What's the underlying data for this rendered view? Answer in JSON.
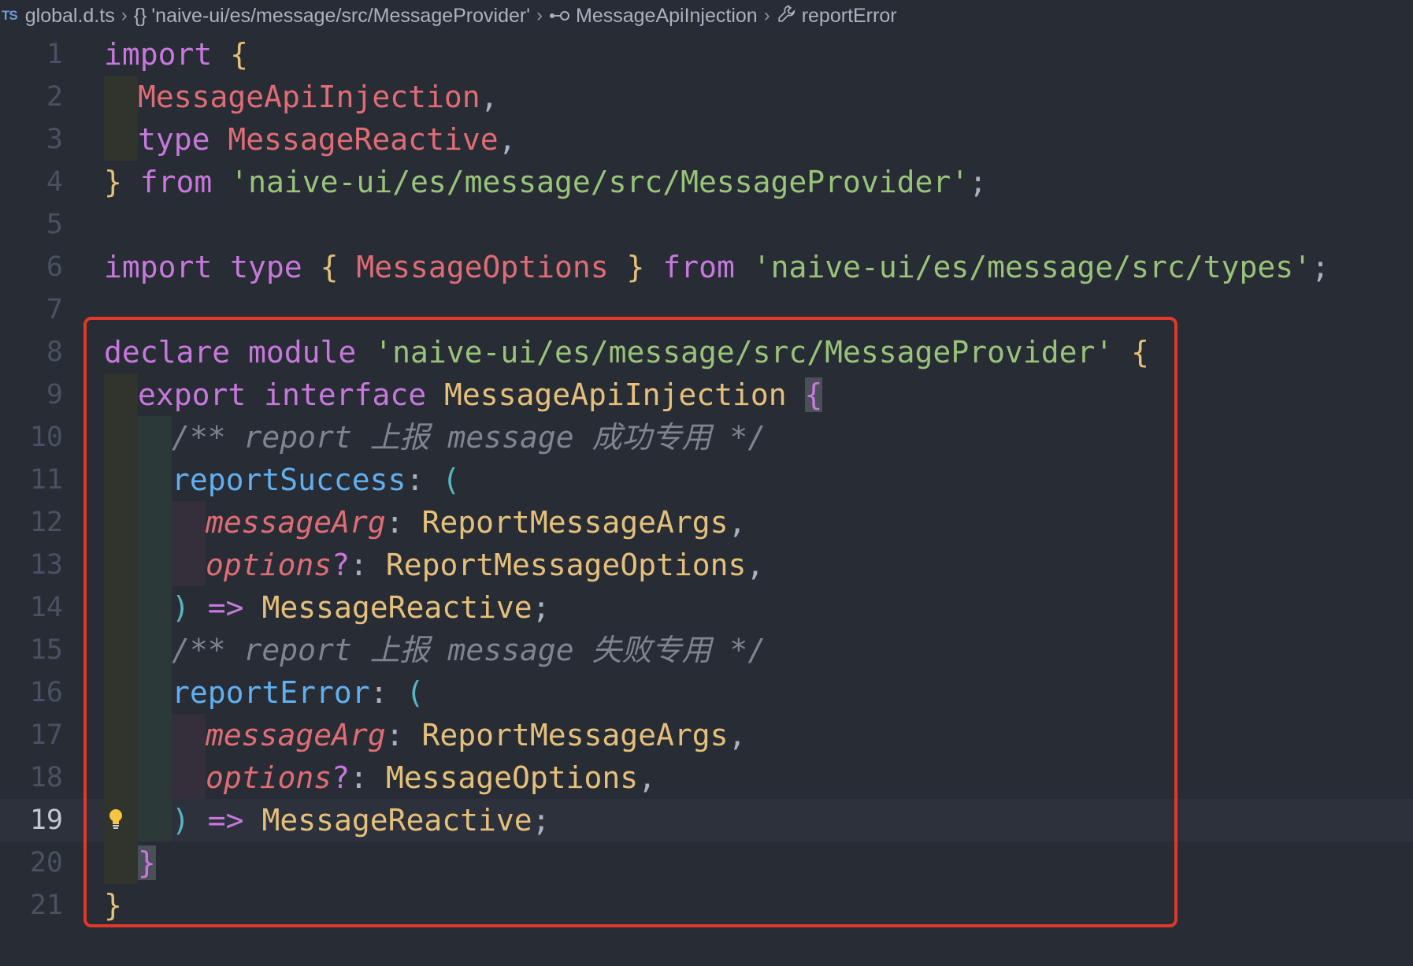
{
  "breadcrumb": {
    "lang_badge": "TS",
    "file": "global.d.ts",
    "module_icon": "{}",
    "module": "'naive-ui/es/message/src/MessageProvider'",
    "interface": "MessageApiInjection",
    "member": "reportError"
  },
  "current_line": 19,
  "lines": [
    {
      "n": "1",
      "tokens": [
        [
          "import",
          "kw"
        ],
        [
          " ",
          ""
        ],
        [
          "{",
          "br1"
        ]
      ]
    },
    {
      "n": "2",
      "tokens": [
        [
          "MessageApiInjection",
          "var"
        ],
        [
          ",",
          ""
        ]
      ]
    },
    {
      "n": "3",
      "tokens": [
        [
          "type",
          "kw"
        ],
        [
          " ",
          ""
        ],
        [
          "MessageReactive",
          "var"
        ],
        [
          ",",
          ""
        ]
      ]
    },
    {
      "n": "4",
      "tokens": [
        [
          "}",
          "br1"
        ],
        [
          " ",
          ""
        ],
        [
          "from",
          "kw"
        ],
        [
          " ",
          ""
        ],
        [
          "'naive-ui/es/message/src/MessageProvider'",
          "str"
        ],
        [
          ";",
          ""
        ]
      ]
    },
    {
      "n": "5",
      "tokens": []
    },
    {
      "n": "6",
      "tokens": [
        [
          "import",
          "kw"
        ],
        [
          " ",
          ""
        ],
        [
          "type",
          "kw"
        ],
        [
          " ",
          ""
        ],
        [
          "{",
          "br1"
        ],
        [
          " ",
          ""
        ],
        [
          "MessageOptions",
          "var"
        ],
        [
          " ",
          ""
        ],
        [
          "}",
          "br1"
        ],
        [
          " ",
          ""
        ],
        [
          "from",
          "kw"
        ],
        [
          " ",
          ""
        ],
        [
          "'naive-ui/es/message/src/types'",
          "str"
        ],
        [
          ";",
          ""
        ]
      ]
    },
    {
      "n": "7",
      "tokens": []
    },
    {
      "n": "8",
      "tokens": [
        [
          "declare",
          "kw"
        ],
        [
          " ",
          ""
        ],
        [
          "module",
          "kw"
        ],
        [
          " ",
          ""
        ],
        [
          "'naive-ui/es/message/src/MessageProvider'",
          "str"
        ],
        [
          " ",
          ""
        ],
        [
          "{",
          "br1"
        ]
      ]
    },
    {
      "n": "9",
      "tokens": [
        [
          "export",
          "kw"
        ],
        [
          " ",
          ""
        ],
        [
          "interface",
          "kw"
        ],
        [
          " ",
          ""
        ],
        [
          "MessageApiInjection",
          "ty"
        ],
        [
          " ",
          ""
        ],
        [
          "{",
          "br2 hl"
        ]
      ]
    },
    {
      "n": "10",
      "tokens": [
        [
          "/** report 上报 message 成功专用 */",
          "cm"
        ]
      ]
    },
    {
      "n": "11",
      "tokens": [
        [
          "reportSuccess",
          "prop"
        ],
        [
          ": ",
          ""
        ],
        [
          "(",
          "br3"
        ]
      ]
    },
    {
      "n": "12",
      "tokens": [
        [
          "messageArg",
          "par"
        ],
        [
          ": ",
          ""
        ],
        [
          "ReportMessageArgs",
          "ty"
        ],
        [
          ",",
          ""
        ]
      ]
    },
    {
      "n": "13",
      "tokens": [
        [
          "options",
          "par"
        ],
        [
          "?",
          "kw"
        ],
        [
          ": ",
          ""
        ],
        [
          "ReportMessageOptions",
          "ty"
        ],
        [
          ",",
          ""
        ]
      ]
    },
    {
      "n": "14",
      "tokens": [
        [
          ")",
          "br3"
        ],
        [
          " ",
          ""
        ],
        [
          "=>",
          "kw"
        ],
        [
          " ",
          ""
        ],
        [
          "MessageReactive",
          "ty"
        ],
        [
          ";",
          ""
        ]
      ]
    },
    {
      "n": "15",
      "tokens": [
        [
          "/** report 上报 message 失败专用 */",
          "cm"
        ]
      ]
    },
    {
      "n": "16",
      "tokens": [
        [
          "reportError",
          "prop"
        ],
        [
          ": ",
          ""
        ],
        [
          "(",
          "br3"
        ]
      ]
    },
    {
      "n": "17",
      "tokens": [
        [
          "messageArg",
          "par"
        ],
        [
          ": ",
          ""
        ],
        [
          "ReportMessageArgs",
          "ty"
        ],
        [
          ",",
          ""
        ]
      ]
    },
    {
      "n": "18",
      "tokens": [
        [
          "options",
          "par"
        ],
        [
          "?",
          "kw"
        ],
        [
          ": ",
          ""
        ],
        [
          "MessageOptions",
          "ty"
        ],
        [
          ",",
          ""
        ]
      ]
    },
    {
      "n": "19",
      "tokens": [
        [
          ")",
          "br3"
        ],
        [
          " ",
          ""
        ],
        [
          "=>",
          "kw"
        ],
        [
          " ",
          ""
        ],
        [
          "MessageReactive",
          "ty"
        ],
        [
          ";",
          ""
        ]
      ]
    },
    {
      "n": "20",
      "tokens": [
        [
          "}",
          "br2 hl"
        ]
      ]
    },
    {
      "n": "21",
      "tokens": [
        [
          "}",
          "br1"
        ]
      ]
    }
  ],
  "colors": {
    "highlight_box": "#e0392b",
    "background": "#282c34",
    "lightbulb": "#f4c542"
  },
  "icons": {
    "lightbulb_line": 19
  }
}
